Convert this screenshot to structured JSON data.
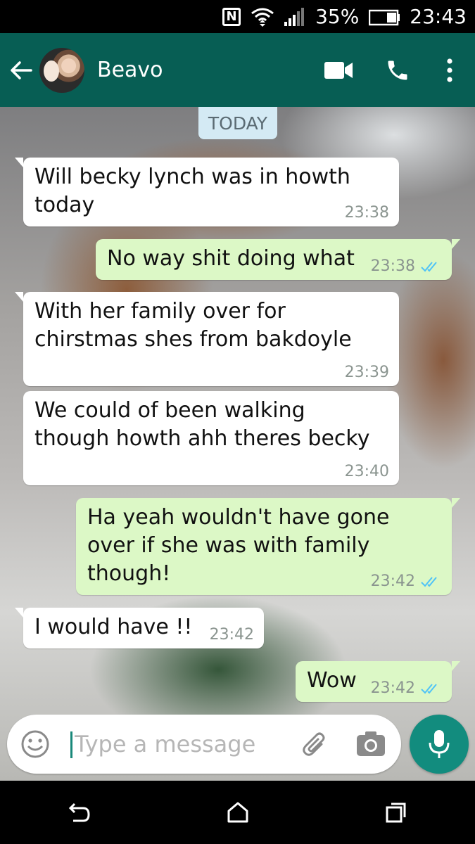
{
  "status_bar": {
    "nfc": "N",
    "battery": "35%",
    "time": "23:43"
  },
  "header": {
    "contact_name": "Beavo",
    "icons": [
      "back-arrow-icon",
      "video-call-icon",
      "voice-call-icon",
      "more-options-icon"
    ]
  },
  "colors": {
    "header": "#075e54",
    "incoming_bubble": "#ffffff",
    "outgoing_bubble": "#dcf8c6",
    "read_tick": "#4fc3f7",
    "mic_button": "#128c7e"
  },
  "chat": {
    "date_chip": "TODAY",
    "messages": [
      {
        "direction": "incoming",
        "text": "Will becky lynch was in howth\ntoday",
        "time": "23:38"
      },
      {
        "direction": "outgoing",
        "text": "No way shit doing what",
        "time": "23:38",
        "status": "read"
      },
      {
        "direction": "incoming",
        "text": "With her family over for\nchirstmas shes from bakdoyle",
        "time": "23:39"
      },
      {
        "direction": "incoming",
        "text": "We could of been walking\nthough howth ahh theres becky",
        "time": "23:40"
      },
      {
        "direction": "outgoing",
        "text": "Ha yeah wouldn't have gone\nover if she was with family\nthough!",
        "time": "23:42",
        "status": "read"
      },
      {
        "direction": "incoming",
        "text": "I would have !!",
        "time": "23:42"
      },
      {
        "direction": "outgoing",
        "text": "Wow",
        "time": "23:42",
        "status": "read"
      }
    ]
  },
  "composer": {
    "placeholder": "Type a message"
  }
}
